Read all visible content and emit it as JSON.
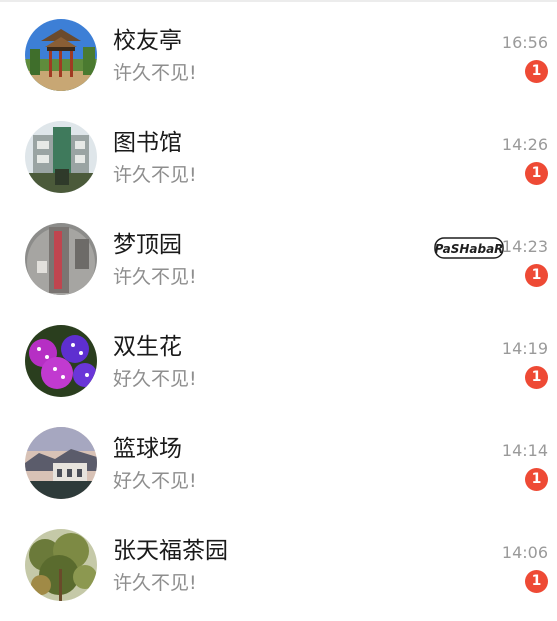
{
  "conversations": [
    {
      "name": "校友亭",
      "preview": "许久不见!",
      "time": "16:56",
      "badge": "1"
    },
    {
      "name": "图书馆",
      "preview": "许久不见!",
      "time": "14:26",
      "badge": "1"
    },
    {
      "name": "梦顶园",
      "preview": "许久不见!",
      "time": "14:23",
      "badge": "1"
    },
    {
      "name": "双生花",
      "preview": "好久不见!",
      "time": "14:19",
      "badge": "1"
    },
    {
      "name": "篮球场",
      "preview": "好久不见!",
      "time": "14:14",
      "badge": "1"
    },
    {
      "name": "张天福茶园",
      "preview": "许久不见!",
      "time": "14:06",
      "badge": "1"
    }
  ],
  "sticker": {
    "text": "PaSHabaR"
  },
  "colors": {
    "badge": "#ee4a35",
    "name_text": "#1a1a1a",
    "preview_text": "#8e8e8e",
    "time_text": "#9a9a9a"
  }
}
